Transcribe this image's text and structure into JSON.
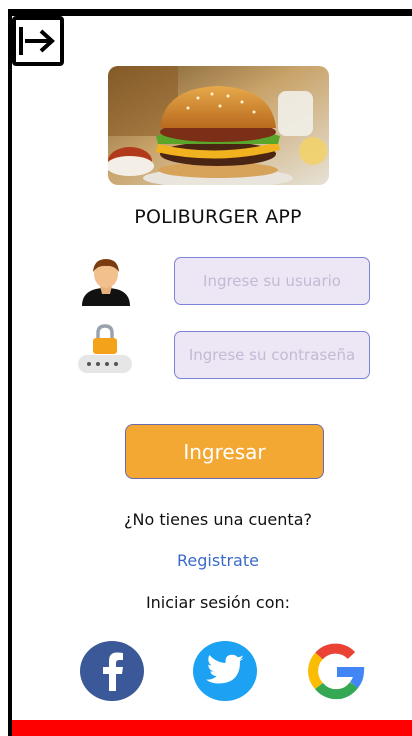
{
  "app": {
    "title": "POLIBURGER APP"
  },
  "header": {
    "exit_icon": "exit-icon"
  },
  "hero": {
    "image": "burger-image"
  },
  "login": {
    "user_icon": "user-icon",
    "user_placeholder": "Ingrese su usuario",
    "user_value": "",
    "password_icon": "lock-password-icon",
    "password_placeholder": "Ingrese su contraseña",
    "password_value": "",
    "submit_label": "Ingresar"
  },
  "register": {
    "question": "¿No tienes una cuenta?",
    "link_label": "Registrate"
  },
  "social": {
    "label": "Iniciar sesión con:",
    "providers": [
      {
        "name": "facebook",
        "icon": "facebook-icon",
        "color": "#3b5998"
      },
      {
        "name": "twitter",
        "icon": "twitter-icon",
        "color": "#1da1f2"
      },
      {
        "name": "google",
        "icon": "google-icon",
        "color": "#4285f4"
      }
    ]
  },
  "colors": {
    "accent_button": "#f3a833",
    "field_bg": "#ece6f5",
    "field_border": "#7b84d6",
    "link": "#3b6bc8",
    "bottom_bar": "#ff0000"
  }
}
